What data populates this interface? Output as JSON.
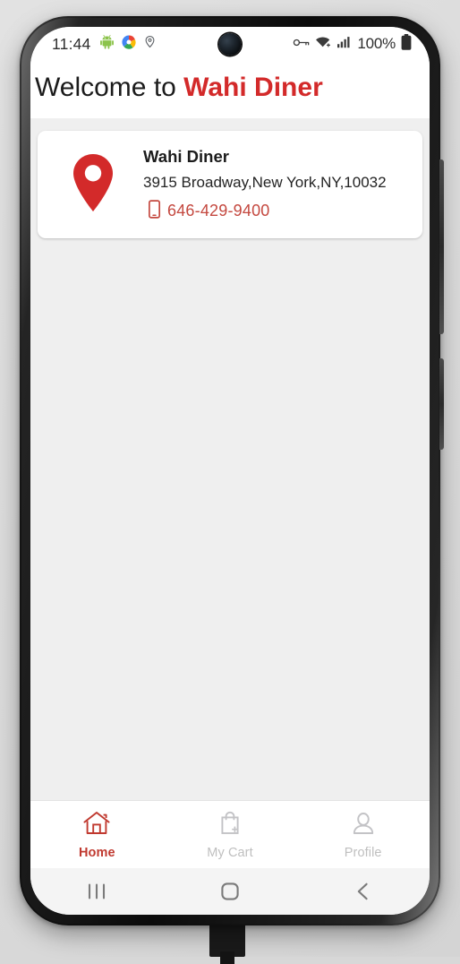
{
  "device": {
    "kind": "android-phone",
    "accessories": {
      "charging_cable": "charging-cable"
    },
    "buttons": {
      "volume": "volume-buttons",
      "power": "power-button"
    }
  },
  "status_bar": {
    "clock": "11:44",
    "left_icons": [
      "android-icon",
      "photos-icon",
      "location-pin-icon"
    ],
    "right_icons": [
      "vpn-key-icon",
      "wifi-icon",
      "cellular-signal-icon"
    ],
    "battery_percent": "100%",
    "battery_icon": "battery-full-icon"
  },
  "header": {
    "greeting": "Welcome to ",
    "brand": "Wahi Diner"
  },
  "card": {
    "pin_icon": "map-pin-icon",
    "name": "Wahi Diner",
    "address": "3915 Broadway,New York,NY,10032",
    "phone_icon": "mobile-phone-icon",
    "phone": "646-429-9400"
  },
  "bottom_nav": {
    "items": [
      {
        "label": "Home",
        "icon": "home-icon",
        "active": true
      },
      {
        "label": "My Cart",
        "icon": "shopping-bag-add-icon",
        "active": false
      },
      {
        "label": "Profile",
        "icon": "person-icon",
        "active": false
      }
    ]
  },
  "android_nav": {
    "recents": "recents-icon",
    "home": "home-square-icon",
    "back": "back-chevron-icon"
  },
  "colors": {
    "brand_red": "#d32a2a",
    "phone_red": "#c4483f",
    "active_tab": "#c0392f",
    "inactive_tab": "#bfbfbf",
    "app_background": "#efefef",
    "card_background": "#ffffff"
  }
}
